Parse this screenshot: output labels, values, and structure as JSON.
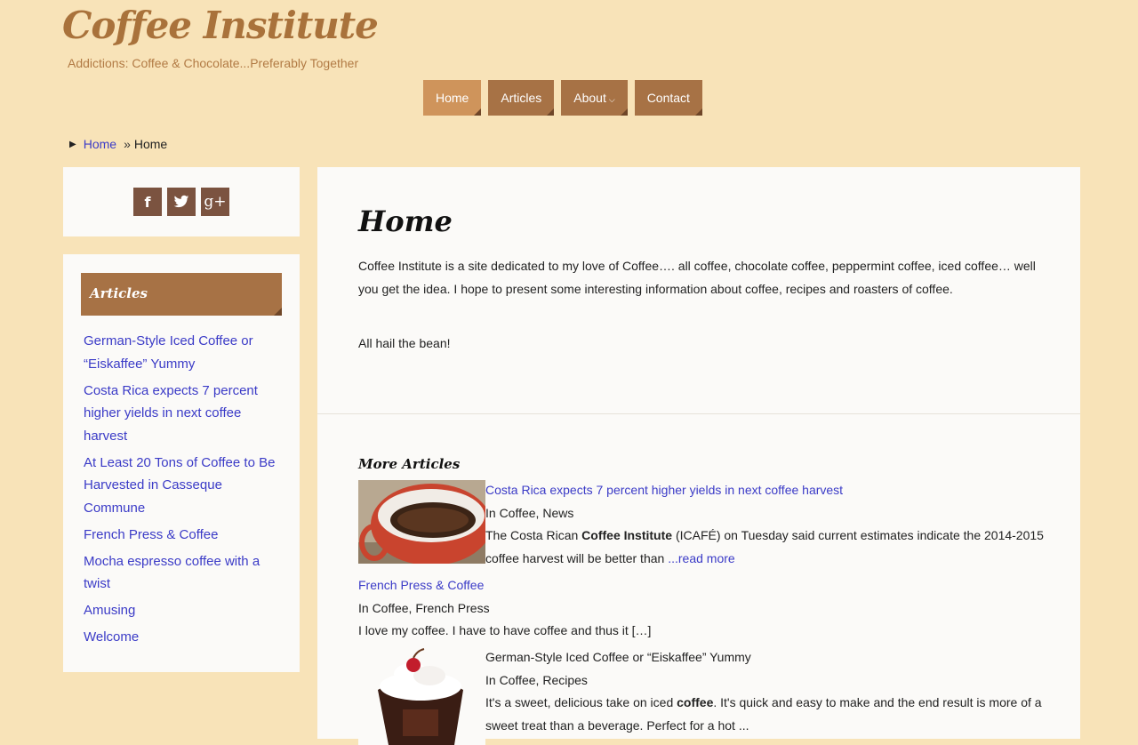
{
  "site": {
    "title": "Coffee Institute",
    "tagline": "Addictions: Coffee & Chocolate...Preferably Together"
  },
  "nav": {
    "home": "Home",
    "articles": "Articles",
    "about": "About",
    "contact": "Contact"
  },
  "breadcrumb": {
    "home": "Home",
    "separator": "»",
    "current": "Home"
  },
  "social": {
    "facebook": "f",
    "twitter": "t",
    "googleplus": "g+"
  },
  "sidebar": {
    "widget_title": "Articles",
    "items": [
      {
        "label": "German-Style Iced Coffee or “Eiskaffee” Yummy"
      },
      {
        "label": "Costa Rica expects 7 percent higher yields in next coffee harvest"
      },
      {
        "label": "At Least 20 Tons of Coffee to Be Harvested in Casseque Commune"
      },
      {
        "label": "French Press & Coffee"
      },
      {
        "label": "Mocha espresso coffee with a twist"
      },
      {
        "label": "Amusing"
      },
      {
        "label": "Welcome"
      }
    ]
  },
  "main": {
    "title": "Home",
    "intro": "Coffee Institute is a site dedicated to my love of Coffee…. all coffee, chocolate coffee, peppermint coffee, iced coffee… well you get the idea. I hope to present some interesting information about coffee, recipes and roasters of coffee.",
    "hail": "All hail the bean!",
    "more_title": "More Articles",
    "posts": [
      {
        "title": "Costa Rica expects 7 percent higher yields in next coffee harvest",
        "meta": "In Coffee, News",
        "excerpt_pre": "The Costa Rican ",
        "excerpt_bold": "Coffee Institute",
        "excerpt_post": " (ICAFÉ) on Tuesday said current estimates indicate the 2014-2015 coffee harvest will be better than ",
        "read_more": "...read more"
      },
      {
        "title": "French Press & Coffee",
        "meta": "In Coffee, French Press",
        "excerpt": "I love my coffee. I have to have coffee and thus it […]"
      },
      {
        "title": "German-Style Iced Coffee or “Eiskaffee” Yummy",
        "meta": "In Coffee, Recipes",
        "excerpt_pre": "It's a sweet, delicious take on iced ",
        "excerpt_bold": "coffee",
        "excerpt_post": ". It's quick and easy to make and the end result is more of a sweet treat than a beverage. Perfect for a hot ..."
      }
    ]
  },
  "colors": {
    "background": "#f8e3b8",
    "accent": "#a77245",
    "accent_active": "#cf945b",
    "link": "#3b3bc7",
    "social": "#7b5340"
  }
}
